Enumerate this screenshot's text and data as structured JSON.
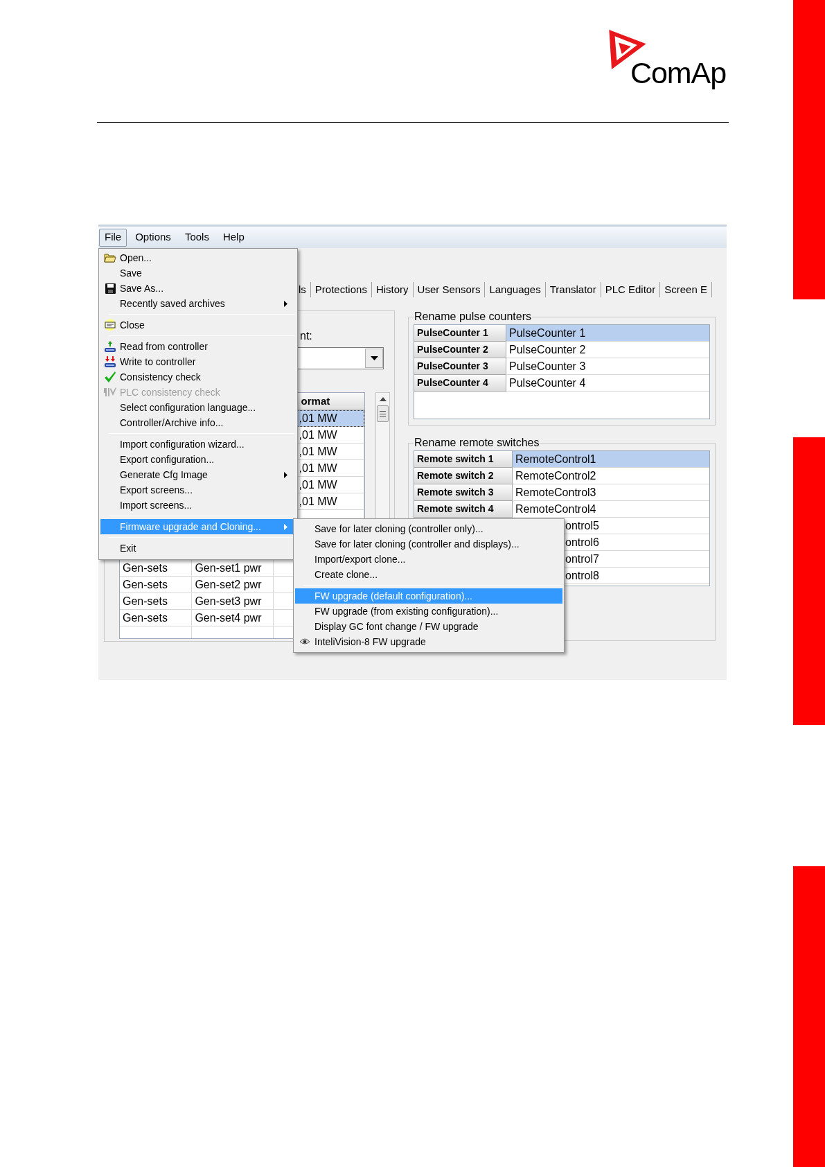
{
  "logo": {
    "text": "ComAp"
  },
  "menubar": [
    {
      "label": "File",
      "selected": true
    },
    {
      "label": "Options",
      "selected": false
    },
    {
      "label": "Tools",
      "selected": false
    },
    {
      "label": "Help",
      "selected": false
    }
  ],
  "tabs": [
    {
      "label": "ls"
    },
    {
      "label": "Protections"
    },
    {
      "label": "History"
    },
    {
      "label": "User Sensors"
    },
    {
      "label": "Languages"
    },
    {
      "label": "Translator"
    },
    {
      "label": "PLC Editor"
    },
    {
      "label": "Screen E"
    }
  ],
  "left_panel": {
    "label": "nt:",
    "format_header": "ormat",
    "upper_rows": [
      {
        "format": ",01 MW",
        "selected": true
      },
      {
        "format": ",01 MW",
        "selected": false
      },
      {
        "format": ",01 MW",
        "selected": false
      },
      {
        "format": ",01 MW",
        "selected": false
      },
      {
        "format": ",01 MW",
        "selected": false
      },
      {
        "format": ",01 MW",
        "selected": false
      }
    ],
    "lower_rows": [
      {
        "group": "Gen-sets",
        "name": "Gen-set1 pwr"
      },
      {
        "group": "Gen-sets",
        "name": "Gen-set2 pwr"
      },
      {
        "group": "Gen-sets",
        "name": "Gen-set3 pwr"
      },
      {
        "group": "Gen-sets",
        "name": "Gen-set4 pwr"
      }
    ]
  },
  "pulse_counters": {
    "title": "Rename pulse counters",
    "rows": [
      {
        "label": "PulseCounter 1",
        "value": "PulseCounter 1",
        "selected": true
      },
      {
        "label": "PulseCounter 2",
        "value": "PulseCounter 2",
        "selected": false
      },
      {
        "label": "PulseCounter 3",
        "value": "PulseCounter 3",
        "selected": false
      },
      {
        "label": "PulseCounter 4",
        "value": "PulseCounter 4",
        "selected": false
      }
    ]
  },
  "remote_switches": {
    "title": "Rename remote switches",
    "rows": [
      {
        "label": "Remote switch 1",
        "value": "RemoteControl1",
        "selected": true
      },
      {
        "label": "Remote switch 2",
        "value": "RemoteControl2",
        "selected": false
      },
      {
        "label": "Remote switch 3",
        "value": "RemoteControl3",
        "selected": false
      },
      {
        "label": "Remote switch 4",
        "value": "RemoteControl4",
        "selected": false
      },
      {
        "value": "ontrol5",
        "selected": false
      },
      {
        "value": "ontrol6",
        "selected": false
      },
      {
        "value": "ontrol7",
        "selected": false
      },
      {
        "value": "ontrol8",
        "selected": false
      }
    ]
  },
  "file_menu": {
    "items": [
      {
        "kind": "item",
        "label": "Open...",
        "disabled": false,
        "submenu": false,
        "selected": false
      },
      {
        "kind": "item",
        "label": "Save",
        "disabled": false,
        "submenu": false,
        "selected": false
      },
      {
        "kind": "item",
        "label": "Save As...",
        "disabled": false,
        "submenu": false,
        "selected": false
      },
      {
        "kind": "item",
        "label": "Recently saved archives",
        "disabled": false,
        "submenu": true,
        "selected": false
      },
      {
        "kind": "separator"
      },
      {
        "kind": "item",
        "label": "Close",
        "disabled": false,
        "submenu": false,
        "selected": false
      },
      {
        "kind": "separator"
      },
      {
        "kind": "item",
        "label": "Read from controller",
        "disabled": false,
        "submenu": false,
        "selected": false
      },
      {
        "kind": "item",
        "label": "Write to controller",
        "disabled": false,
        "submenu": false,
        "selected": false
      },
      {
        "kind": "item",
        "label": "Consistency check",
        "disabled": false,
        "submenu": false,
        "selected": false
      },
      {
        "kind": "item",
        "label": "PLC consistency check",
        "disabled": true,
        "submenu": false,
        "selected": false
      },
      {
        "kind": "item",
        "label": "Select configuration language...",
        "disabled": false,
        "submenu": false,
        "selected": false
      },
      {
        "kind": "item",
        "label": "Controller/Archive info...",
        "disabled": false,
        "submenu": false,
        "selected": false
      },
      {
        "kind": "separator"
      },
      {
        "kind": "item",
        "label": "Import configuration wizard...",
        "disabled": false,
        "submenu": false,
        "selected": false
      },
      {
        "kind": "item",
        "label": "Export configuration...",
        "disabled": false,
        "submenu": false,
        "selected": false
      },
      {
        "kind": "item",
        "label": "Generate Cfg Image",
        "disabled": false,
        "submenu": true,
        "selected": false
      },
      {
        "kind": "item",
        "label": "Export screens...",
        "disabled": false,
        "submenu": false,
        "selected": false
      },
      {
        "kind": "item",
        "label": "Import screens...",
        "disabled": false,
        "submenu": false,
        "selected": false
      },
      {
        "kind": "separator"
      },
      {
        "kind": "item",
        "label": "Firmware upgrade and Cloning...",
        "disabled": false,
        "submenu": true,
        "selected": true
      },
      {
        "kind": "separator"
      },
      {
        "kind": "item",
        "label": "Exit",
        "disabled": false,
        "submenu": false,
        "selected": false
      }
    ]
  },
  "submenu": {
    "items": [
      {
        "kind": "item",
        "label": "Save for later cloning (controller only)...",
        "selected": false
      },
      {
        "kind": "item",
        "label": "Save for later cloning (controller and displays)...",
        "selected": false
      },
      {
        "kind": "item",
        "label": "Import/export clone...",
        "selected": false
      },
      {
        "kind": "item",
        "label": "Create clone...",
        "selected": false
      },
      {
        "kind": "separator"
      },
      {
        "kind": "item",
        "label": "FW upgrade (default configuration)...",
        "selected": true
      },
      {
        "kind": "item",
        "label": "FW upgrade (from existing configuration)...",
        "selected": false
      },
      {
        "kind": "item",
        "label": "Display GC font change / FW upgrade",
        "selected": false
      },
      {
        "kind": "item",
        "label": "InteliVision-8 FW upgrade",
        "selected": false
      }
    ]
  }
}
